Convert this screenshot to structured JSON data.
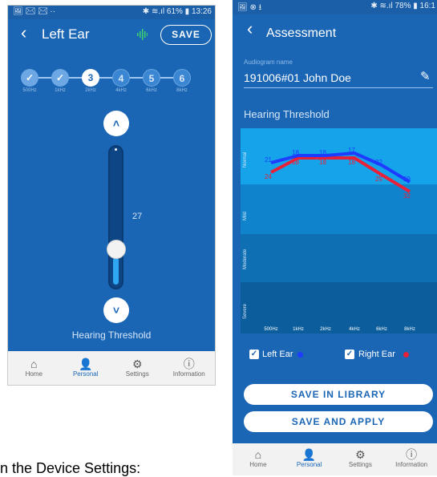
{
  "left_phone": {
    "status": {
      "icons_left": "🖼 ✉ ✉ ··",
      "right_text": "✱ ≋.ıl 61% ▮ 13:26"
    },
    "appbar": {
      "back_icon": "‹",
      "title": "Left Ear",
      "save_label": "SAVE"
    },
    "steps": [
      {
        "label": "✓",
        "freq": "500Hz",
        "state": "done"
      },
      {
        "label": "✓",
        "freq": "1kHz",
        "state": "done"
      },
      {
        "label": "3",
        "freq": "2kHz",
        "state": "current"
      },
      {
        "label": "4",
        "freq": "4kHz",
        "state": "todo"
      },
      {
        "label": "5",
        "freq": "6kHz",
        "state": "todo"
      },
      {
        "label": "6",
        "freq": "8kHz",
        "state": "todo"
      }
    ],
    "slider": {
      "value": "27",
      "up_icon": "˄",
      "down_icon": "˅",
      "level_fraction": 0.27
    },
    "slider_caption": "Hearing Threshold",
    "nav": [
      {
        "label": "Home",
        "icon": "⌂"
      },
      {
        "label": "Personal",
        "icon": "👤"
      },
      {
        "label": "Settings",
        "icon": "⚙"
      },
      {
        "label": "Information",
        "icon": "ⓘ"
      }
    ]
  },
  "right_phone": {
    "status": {
      "icons_left": "🖼 ⊗ ⭳",
      "right_text": "✱ ≋.ıl 78% ▮ 16:1"
    },
    "appbar": {
      "back_icon": "‹",
      "title": "Assessment"
    },
    "audiogram_label": "Audiogram name",
    "audiogram_value": "191006#01 John Doe",
    "edit_icon": "✎",
    "section_title": "Hearing Threshold",
    "bands": [
      "Normal",
      "Mild",
      "Moderate",
      "Severe"
    ],
    "freq_ticks": [
      "500Hz",
      "1kHz",
      "2kHz",
      "4kHz",
      "6kHz",
      "8kHz"
    ],
    "left_values": [
      "21",
      "18",
      "18",
      "17",
      "22",
      "29"
    ],
    "right_values": [
      "24",
      "18",
      "18",
      "18",
      "25",
      "32"
    ],
    "left_ear_label": "Left Ear",
    "right_ear_label": "Right Ear",
    "check_icon": "✓",
    "save_library": "SAVE IN LIBRARY",
    "save_apply": "SAVE AND APPLY",
    "nav": [
      {
        "label": "Home",
        "icon": "⌂"
      },
      {
        "label": "Personal",
        "icon": "👤"
      },
      {
        "label": "Settings",
        "icon": "⚙"
      },
      {
        "label": "Information",
        "icon": "ⓘ"
      }
    ],
    "colors": {
      "left_series": "#1e3cff",
      "right_series": "#e8213a",
      "accent": "#1a66b5"
    }
  },
  "caption": "n the Device Settings:"
}
